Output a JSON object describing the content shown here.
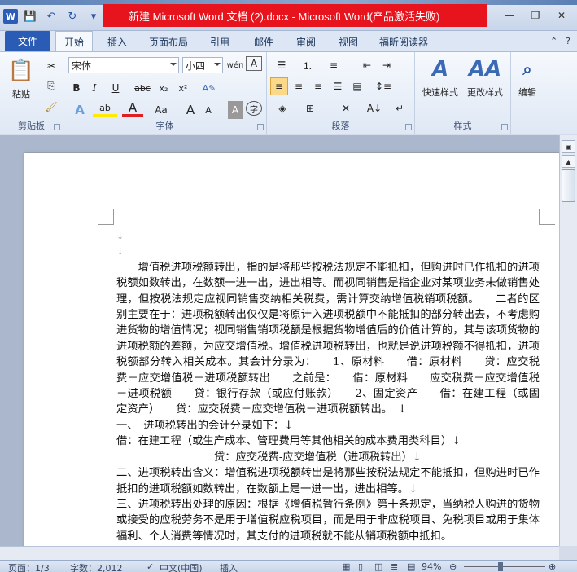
{
  "window": {
    "title": "新建 Microsoft Word 文档 (2).docx - Microsoft Word(产品激活失败)",
    "logo": "W"
  },
  "qat": {
    "save": "💾",
    "undo": "↶",
    "redo": "↻",
    "more": "▾"
  },
  "tabs": {
    "file": "文件",
    "items": [
      "开始",
      "插入",
      "页面布局",
      "引用",
      "邮件",
      "审阅",
      "视图",
      "福昕阅读器"
    ]
  },
  "ribbon": {
    "clipboard": {
      "label": "剪贴板",
      "paste": "粘贴"
    },
    "font": {
      "label": "字体",
      "name": "宋体",
      "size": "小四",
      "bold": "B",
      "italic": "I",
      "underline": "U",
      "strike": "abc",
      "sub": "x₂",
      "sup": "x²",
      "grow": "A",
      "shrink": "A",
      "case": "Aa",
      "color": "A"
    },
    "paragraph": {
      "label": "段落"
    },
    "styles": {
      "label": "样式",
      "quick": "快速样式",
      "change": "更改样式"
    },
    "editing": {
      "label": "编辑"
    }
  },
  "document": {
    "marks": [
      "↓",
      "↓"
    ],
    "paragraphs": [
      "增值税进项税额转出，指的是将那些按税法规定不能抵扣，但购进时已作抵扣的进项税额如数转出，在数额一进一出，进出相等。而视同销售是指企业对某项业务未做销售处理，但按税法规定应视同销售交纳相关税费，需计算交纳增值税销项税额。　　二者的区别主要在于：进项税额转出仅仅是将原计入进项税额中不能抵扣的部分转出去，不考虑购进货物的增值情况；视同销售销项税额是根据货物增值后的价值计算的，其与该项货物的进项税额的差额，为应交增值税。增值税进项税转出，也就是说进项税额不得抵扣，进项税额部分转入相关成本。其会计分录为：　　1、原材料　　借：原材料　　贷：应交税费－应交增值税－进项税额转出　　之前是：　　借：原材料　　应交税费－应交增值税－进项税额　　贷：银行存款（或应付账款）　　2、固定资产　　借：在建工程（或固定资产）　　贷：应交税费－应交增值税－进项税额转出。　↓",
      "一、　进项税转出的会计分录如下：↓",
      "借：在建工程（或生产成本、管理费用等其他相关的成本费用类科目）↓",
      "贷：应交税费-应交增值税（进项税转出）↓",
      "二、进项税转出含义：增值税进项税额转出是将那些按税法规定不能抵扣，但购进时已作抵扣的进项税额如数转出，在数额上是一进一出，进出相等。↓",
      "三、进项税转出处理的原因：根据《增值税暂行条例》第十条规定，当纳税人购进的货物或接受的应税劳务不是用于增值税应税项目，而是用于非应税项目、免税项目或用于集体福利、个人消费等情况时，其支付的进项税就不能从销项税额中抵扣。"
    ]
  },
  "status": {
    "page": "页面：1/3",
    "words": "字数：2,012",
    "lang": "中文(中国)",
    "mode": "插入",
    "zoom": "94%"
  }
}
